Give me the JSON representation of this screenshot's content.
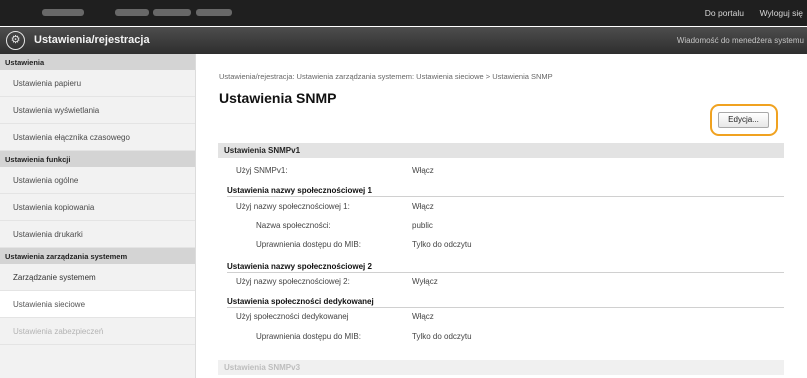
{
  "topbar": {
    "portal": "Do portalu",
    "logout": "Wyloguj się"
  },
  "titlebar": {
    "title": "Ustawienia/rejestracja",
    "message": "Wiadomość do menedżera systemu",
    "logo_icon": "settings-registration-icon"
  },
  "sidebar": {
    "group1": "Ustawienia",
    "paper": "Ustawienia papieru",
    "display": "Ustawienia wyświetlania",
    "timer": "Ustawienia ełącznika czasowego",
    "group2": "Ustawienia funkcji",
    "general": "Ustawienia ogólne",
    "copy": "Ustawienia kopiowania",
    "printer": "Ustawienia drukarki",
    "group3": "Ustawienia zarządzania systemem",
    "sysmgmt": "Zarządzanie systemem",
    "network": "Ustawienia sieciowe",
    "security": "Ustawienia zabezpieczeń"
  },
  "main": {
    "breadcrumb": "Ustawienia/rejestracja: Ustawienia zarządzania systemem: Ustawienia sieciowe > Ustawienia SNMP",
    "title": "Ustawienia SNMP",
    "edit_label": "Edycja...",
    "snmpv1": {
      "heading": "Ustawienia SNMPv1",
      "use_label": "Użyj SNMPv1:",
      "use_value": "Włącz"
    },
    "community1": {
      "heading": "Ustawienia nazwy społecznościowej 1",
      "use_label": "Użyj nazwy społecznościowej 1:",
      "use_value": "Włącz",
      "name_label": "Nazwa społeczności:",
      "name_value": "public",
      "mib_label": "Uprawnienia dostępu do MIB:",
      "mib_value": "Tylko do odczytu"
    },
    "community2": {
      "heading": "Ustawienia nazwy społecznościowej 2",
      "use_label": "Użyj nazwy społecznościowej 2:",
      "use_value": "Wyłącz"
    },
    "dedicated": {
      "heading": "Ustawienia społeczności dedykowanej",
      "use_label": "Użyj społeczności dedykowanej",
      "use_value": "Włącz",
      "mib_label": "Uprawnienia dostępu do MIB:",
      "mib_value": "Tylko do odczytu"
    },
    "snmpv3_heading": "Ustawienia SNMPv3"
  },
  "colors": {
    "accent_highlight": "#f0a220",
    "topbar": "#1f1f1f",
    "titlebar": "#3a3a3a"
  }
}
